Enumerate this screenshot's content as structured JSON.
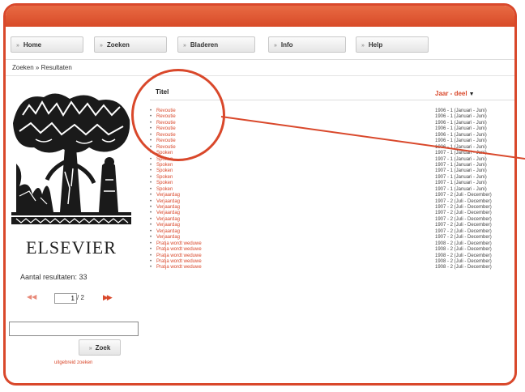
{
  "nav": {
    "home": "Home",
    "zoeken": "Zoeken",
    "bladeren": "Bladeren",
    "info": "Info",
    "help": "Help"
  },
  "breadcrumb": "Zoeken » Resultaten",
  "sidebar": {
    "publisher": "ELSEVIER",
    "results_label": "Aantal resultaten: 33",
    "pager_current": "1",
    "pager_total": "/ 2",
    "search_value": "",
    "search_button": "Zoek",
    "advanced_link": "uitgebreid zoeken"
  },
  "table": {
    "col_title": "Titel",
    "col_year": "Jaar - deel",
    "rows": [
      {
        "title": "Revoutie",
        "year": "1906 - 1 (Januari - Juni)"
      },
      {
        "title": "Revoutie",
        "year": "1906 - 1 (Januari - Juni)"
      },
      {
        "title": "Revoutie",
        "year": "1906 - 1 (Januari - Juni)"
      },
      {
        "title": "Revoutie",
        "year": "1906 - 1 (Januari - Juni)"
      },
      {
        "title": "Revoutie",
        "year": "1906 - 1 (Januari - Juni)"
      },
      {
        "title": "Revoutie",
        "year": "1906 - 1 (Januari - Juni)"
      },
      {
        "title": "Revoutie",
        "year": "1906 - 1 (Januari - Juni)"
      },
      {
        "title": "Spoken",
        "year": "1907 - 1 (Januari - Juni)"
      },
      {
        "title": "Spoken",
        "year": "1907 - 1 (Januari - Juni)"
      },
      {
        "title": "Spoken",
        "year": "1907 - 1 (Januari - Juni)"
      },
      {
        "title": "Spoken",
        "year": "1907 - 1 (Januari - Juni)"
      },
      {
        "title": "Spoken",
        "year": "1907 - 1 (Januari - Juni)"
      },
      {
        "title": "Spoken",
        "year": "1907 - 1 (Januari - Juni)"
      },
      {
        "title": "Spoken",
        "year": "1907 - 1 (Januari - Juni)"
      },
      {
        "title": "Verjaardag",
        "year": "1907 - 2 (Juli - December)"
      },
      {
        "title": "Verjaardag",
        "year": "1907 - 2 (Juli - December)"
      },
      {
        "title": "Verjaardag",
        "year": "1907 - 2 (Juli - December)"
      },
      {
        "title": "Verjaardag",
        "year": "1907 - 2 (Juli - December)"
      },
      {
        "title": "Verjaardag",
        "year": "1907 - 2 (Juli - December)"
      },
      {
        "title": "Verjaardag",
        "year": "1907 - 2 (Juli - December)"
      },
      {
        "title": "Verjaardag",
        "year": "1907 - 2 (Juli - December)"
      },
      {
        "title": "Verjaardag",
        "year": "1907 - 2 (Juli - December)"
      },
      {
        "title": "Pratja wordt weduwe",
        "year": "1908 - 2 (Juli - December)"
      },
      {
        "title": "Pratja wordt weduwe",
        "year": "1908 - 2 (Juli - December)"
      },
      {
        "title": "Pratja wordt weduwe",
        "year": "1908 - 2 (Juli - December)"
      },
      {
        "title": "Pratja wordt weduwe",
        "year": "1908 - 2 (Juli - December)"
      },
      {
        "title": "Pratja wordt weduwe",
        "year": "1908 - 2 (Juli - December)"
      }
    ]
  },
  "colors": {
    "accent": "#d9482b",
    "link": "#d9482b",
    "text": "#333333"
  },
  "icons": {
    "nav_arrow": "arrow-right-icon",
    "first_page": "first-page-icon",
    "next_page": "next-page-icon",
    "sort": "sort-down-icon"
  }
}
